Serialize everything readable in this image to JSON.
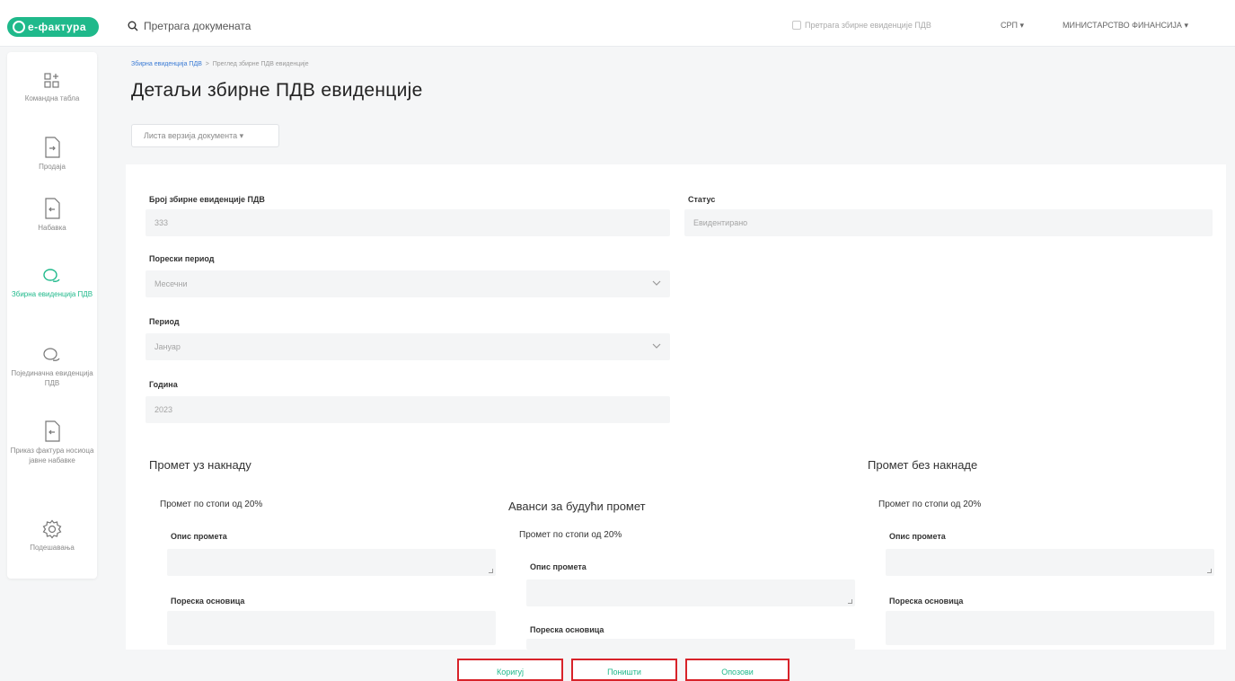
{
  "topbar": {
    "logo": "е-фактура",
    "search_placeholder": "Претрага докумената",
    "checkbox_label": "Претрага збирне евиденције ПДВ",
    "language": "СРП",
    "organization": "МИНИСТАРСТВО ФИНАНСИЈА"
  },
  "sidebar": {
    "items": [
      {
        "label": "Командна табла",
        "icon": "dashboard-icon"
      },
      {
        "label": "Продаја",
        "icon": "document-out-icon"
      },
      {
        "label": "Набавка",
        "icon": "document-in-icon"
      },
      {
        "label": "Збирна евиденција ПДВ",
        "icon": "chat-bubbles-icon"
      },
      {
        "label": "Појединачна евиденција ПДВ",
        "icon": "chat-bubbles-icon"
      },
      {
        "label": "Приказ фактура носиоца јавне набавке",
        "icon": "document-in-icon"
      },
      {
        "label": "Подешавања",
        "icon": "gear-icon"
      }
    ],
    "active_index": 3
  },
  "breadcrumb": {
    "parent": "Збирна евиденција ПДВ",
    "separator": ">",
    "current": "Преглед збирне ПДВ евиденције"
  },
  "page_title": "Детаљи збирне ПДВ евиденције",
  "versions_dropdown": "Листа верзија документа",
  "form": {
    "number_label": "Број збирне евиденције ПДВ",
    "number_value": "333",
    "status_label": "Статус",
    "status_value": "Евидентирано",
    "tax_period_label": "Порески период",
    "tax_period_value": "Месечни",
    "period_label": "Период",
    "period_value": "Јануар",
    "year_label": "Година",
    "year_value": "2023"
  },
  "sections": {
    "with_fee": {
      "title": "Промет уз накнаду",
      "rate_title": "Промет по стопи од 20%",
      "desc_label": "Опис промета",
      "base_label": "Пореска основица"
    },
    "advances": {
      "title": "Аванси за будући промет",
      "rate_title": "Промет по стопи од 20%",
      "desc_label": "Опис промета",
      "base_label": "Пореска основица"
    },
    "without_fee": {
      "title": "Промет без накнаде",
      "rate_title": "Промет по стопи од 20%",
      "desc_label": "Опис промета",
      "base_label": "Пореска основица"
    }
  },
  "buttons": {
    "correct": "Коригуј",
    "cancel": "Поништи",
    "withdraw": "Опозови"
  },
  "colors": {
    "brand": "#1fb98b",
    "highlight": "#d8232a"
  }
}
